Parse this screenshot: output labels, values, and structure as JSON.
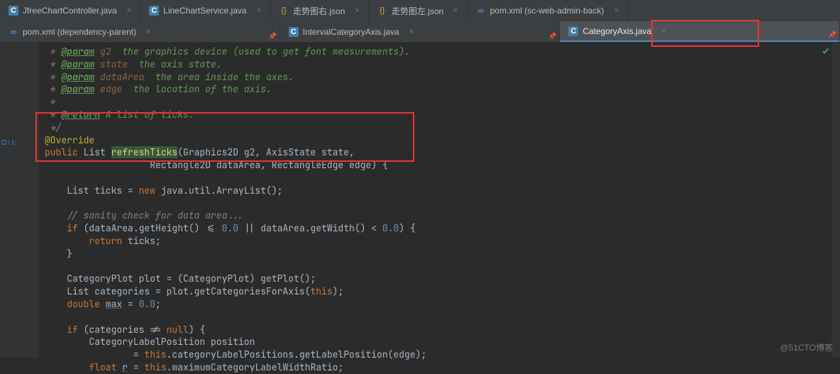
{
  "tabsRow1": [
    {
      "icon": "java",
      "label": "JfreeChartController.java"
    },
    {
      "icon": "java",
      "label": "LineChartService.java"
    },
    {
      "icon": "json",
      "label": "走势图右.json"
    },
    {
      "icon": "json",
      "label": "走势图左.json"
    },
    {
      "icon": "m",
      "label": "pom.xml (sc-web-admin-back)"
    }
  ],
  "tabsRow2": [
    {
      "icon": "m",
      "label": "pom.xml (dependency-parent)"
    },
    {
      "icon": "java",
      "label": "IntervalCategoryAxis.java"
    },
    {
      "icon": "java",
      "label": "CategoryAxis.java",
      "active": true
    }
  ],
  "code": {
    "l1a": " * ",
    "l1b": "@param",
    "l1c": " g2",
    "l1d": "  the graphics device (used to get font measurements).",
    "l2a": " * ",
    "l2b": "@param",
    "l2c": " state",
    "l2d": "  the axis state.",
    "l3a": " * ",
    "l3b": "@param",
    "l3c": " dataArea",
    "l3d": "  the area inside the axes.",
    "l4a": " * ",
    "l4b": "@param",
    "l4c": " edge",
    "l4d": "  the location of the axis.",
    "l5": " *",
    "l6a": " * ",
    "l6b": "@return",
    "l6c": " A list of ticks.",
    "l7": " */",
    "l8": "@Override",
    "l9a": "public",
    "l9b": " List ",
    "l9c": "refreshTicks",
    "l9d": "(Graphics2D g2, AxisState state,",
    "l10": "                   Rectangle2D dataArea, RectangleEdge edge) {",
    "l11": "",
    "l12a": "    List ticks = ",
    "l12b": "new",
    "l12c": " java.util.ArrayList()",
    "l13": "",
    "l14": "    // sanity check for data area...",
    "l15a": "    if",
    "l15b": " (dataArea.getHeight() <= ",
    "l15c": "0.0",
    "l15d": " || dataArea.getWidth() < ",
    "l15e": "0.0",
    "l15f": ") {",
    "l16a": "        return",
    "l16b": " ticks",
    "l17": "    }",
    "l18": "",
    "l19a": "    CategoryPlot plot = (CategoryPlot) ",
    "l19b": "getPlot",
    "l19c": "()",
    "l20a": "    List categories = plot.",
    "l20b": "getCategoriesForAxis",
    "l20c": "(",
    "l20d": "this",
    "l20e": ")",
    "l21a": "    double ",
    "l21b": "max",
    "l21c": " = ",
    "l21d": "0.0",
    "l22": "",
    "l23a": "    if",
    "l23b": " (categories != ",
    "l23c": "null",
    "l23d": ") {",
    "l24": "        CategoryLabelPosition position",
    "l25a": "                = ",
    "l25b": "this",
    "l25c": ".",
    "l25d": "categoryLabelPositions",
    "l25e": ".getLabelPosition(edge)",
    "l26a": "        float ",
    "l26b": "r",
    "l26c": " = ",
    "l26d": "this",
    "l26e": ".",
    "l26f": "maximumCategoryLabelWidthRatio"
  },
  "watermark": "@51CTO博客"
}
